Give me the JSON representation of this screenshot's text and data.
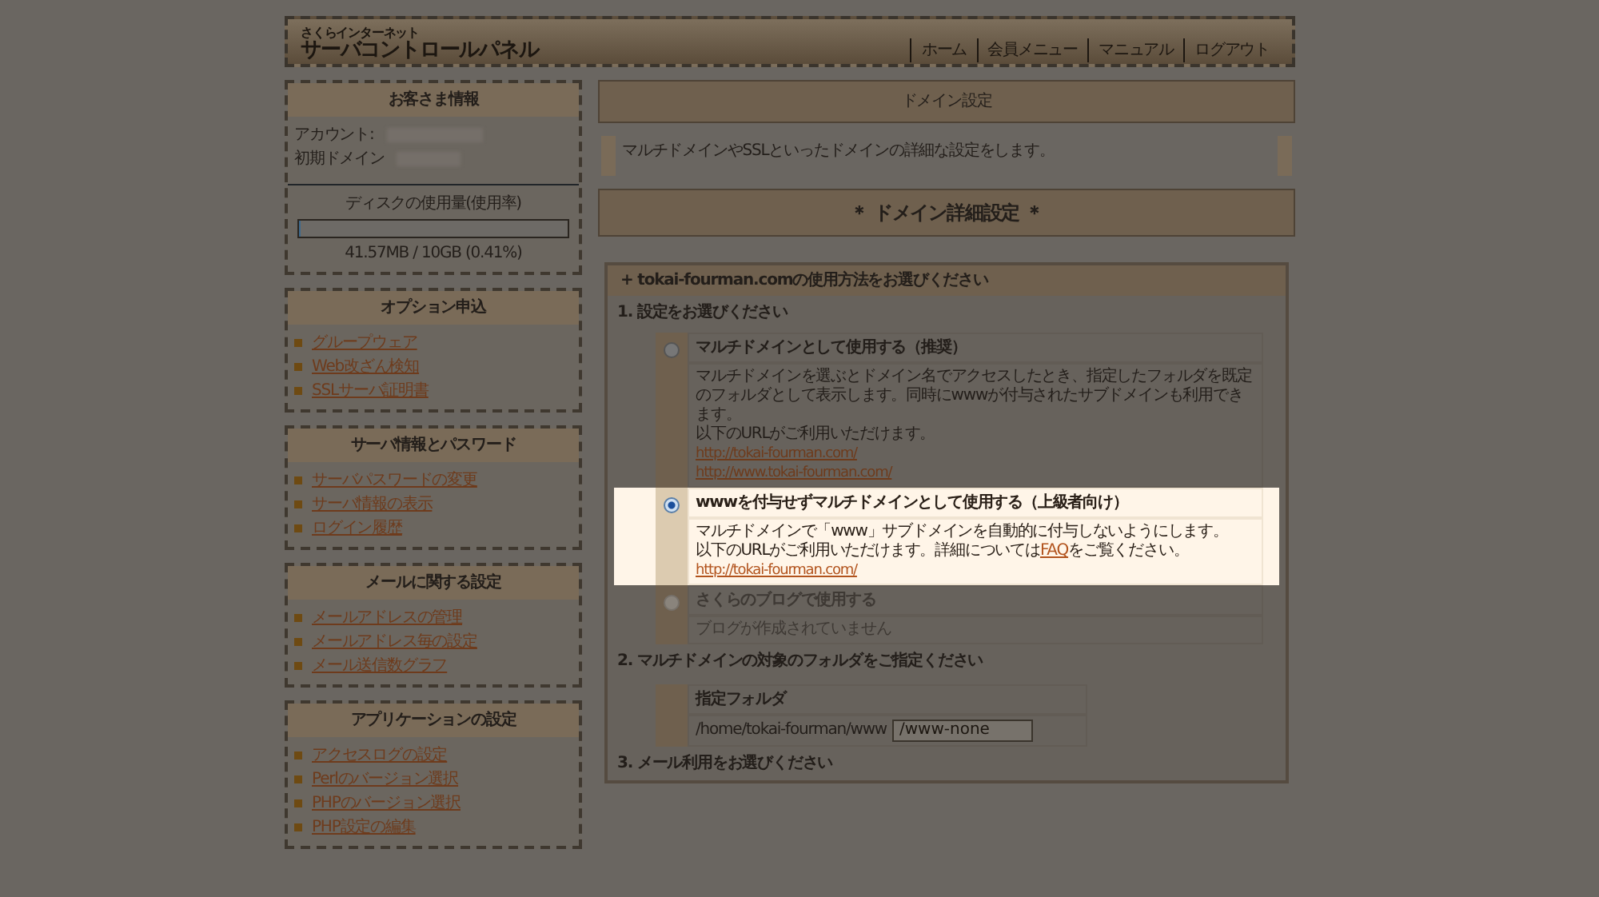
{
  "header": {
    "brand_small": "さくらインターネット",
    "brand": "サーバコントロールパネル",
    "nav": [
      "ホーム",
      "会員メニュー",
      "マニュアル",
      "ログアウト"
    ]
  },
  "customer": {
    "title": "お客さま情報",
    "fields": [
      {
        "label": "アカウント:"
      },
      {
        "label": "初期ドメイン"
      }
    ],
    "disk_title": "ディスクの使用量(使用率)",
    "disk": {
      "level": 0.0041
    },
    "disk_reading": "41.57MB / 10GB (0.41%)"
  },
  "menus": [
    {
      "title": "オプション申込",
      "links": [
        "グループウェア",
        "Web改ざん検知",
        "SSLサーバ証明書"
      ]
    },
    {
      "title": "サーバ情報とパスワード",
      "links": [
        "サーバパスワードの変更",
        "サーバ情報の表示",
        "ログイン履歴"
      ]
    },
    {
      "title": "メールに関する設定",
      "links": [
        "メールアドレスの管理",
        "メールアドレス毎の設定",
        "メール送信数グラフ"
      ]
    },
    {
      "title": "アプリケーションの設定",
      "links": [
        "アクセスログの設定",
        "Perlのバージョン選択",
        "PHPのバージョン選択",
        "PHP設定の編集"
      ]
    }
  ],
  "main": {
    "title": "ドメイン設定",
    "intro": "マルチドメインやSSLといったドメインの詳細な設定をします。",
    "section_title": "＊ ドメイン詳細設定 ＊",
    "form_title": "+ tokai-fourman.comの使用方法をお選びください",
    "step1": "1. 設定をお選びください",
    "options": [
      {
        "title": "マルチドメインとして使用する（推奨）",
        "selected": false,
        "disabled": false,
        "lines": [
          {
            "text": "マルチドメインを選ぶとドメイン名でアクセスしたとき、指定したフォルダを既定のフォルダとして表示します。同時にwwwが付与されたサブドメインも利用できます。"
          },
          {
            "text": "以下のURLがご利用いただけます。"
          }
        ],
        "urls": [
          "http://tokai-fourman.com/",
          "http://www.tokai-fourman.com/"
        ]
      },
      {
        "title": "wwwを付与せずマルチドメインとして使用する（上級者向け）",
        "selected": true,
        "disabled": false,
        "lines": [
          {
            "text": "マルチドメインで「www」サブドメインを自動的に付与しないようにします。"
          },
          {
            "text": "以下のURLがご利用いただけます。詳細については",
            "link": "FAQ",
            "after": "をご覧ください。"
          }
        ],
        "urls": [
          "http://tokai-fourman.com/"
        ]
      },
      {
        "title": "さくらのブログで使用する",
        "selected": false,
        "disabled": true,
        "lines": [
          {
            "text": "ブログが作成されていません"
          }
        ]
      }
    ],
    "step2": "2. マルチドメインの対象のフォルダをご指定ください",
    "folder_label": "指定フォルダ",
    "folder_prefix": "/home/tokai-fourman/www",
    "folder_value": "/www-none",
    "step3": "3. メール利用をお選びください"
  }
}
